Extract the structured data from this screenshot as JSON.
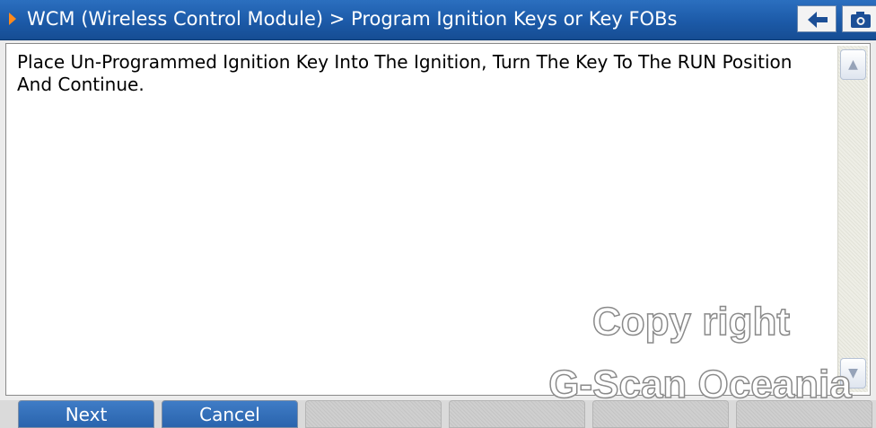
{
  "title": {
    "breadcrumb": "WCM (Wireless Control Module) > Program Ignition Keys or Key FOBs",
    "arrow_color": "#ff8a1c"
  },
  "toolbar": {
    "back_icon": "back-arrow-icon",
    "camera_icon": "camera-icon"
  },
  "message": {
    "text": "Place Un-Programmed Ignition Key Into The Ignition, Turn The Key To The RUN Position And Continue."
  },
  "watermark": {
    "line1": "Copy right",
    "line2": "G-Scan Oceania"
  },
  "function_buttons": [
    {
      "label": "Next"
    },
    {
      "label": "Cancel"
    },
    {
      "label": ""
    },
    {
      "label": ""
    },
    {
      "label": ""
    },
    {
      "label": ""
    }
  ],
  "colors": {
    "title_bar": "#1c5aa8",
    "button_active": "#2f6cb6",
    "button_text": "#ffffff"
  }
}
